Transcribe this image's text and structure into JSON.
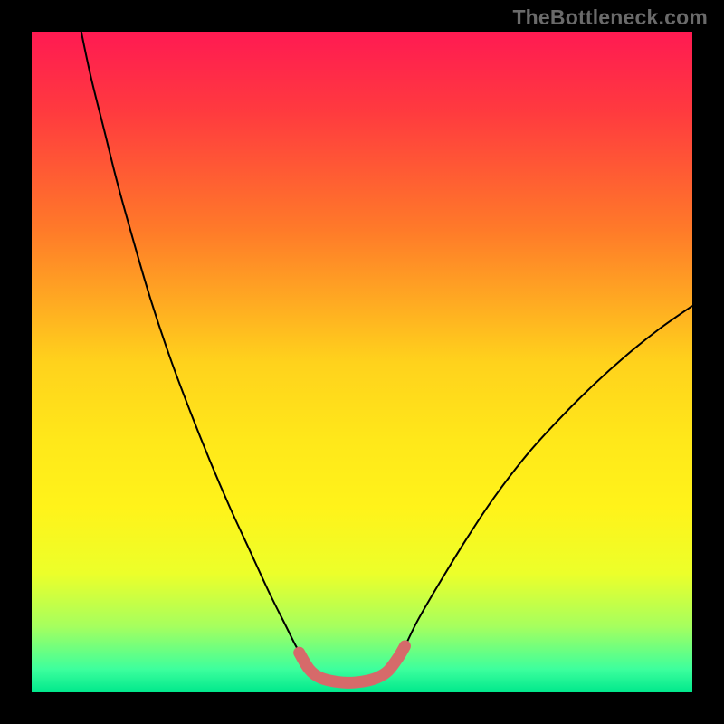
{
  "watermark": "TheBottleneck.com",
  "chart_data": {
    "type": "line",
    "title": "",
    "xlabel": "",
    "ylabel": "",
    "xlim": [
      0,
      100
    ],
    "ylim": [
      0,
      100
    ],
    "gradient_stops": [
      {
        "offset": 0.0,
        "color": "#ff1a52"
      },
      {
        "offset": 0.12,
        "color": "#ff3a3f"
      },
      {
        "offset": 0.3,
        "color": "#ff7a29"
      },
      {
        "offset": 0.5,
        "color": "#ffd21c"
      },
      {
        "offset": 0.62,
        "color": "#ffe81a"
      },
      {
        "offset": 0.72,
        "color": "#fff31a"
      },
      {
        "offset": 0.82,
        "color": "#ecff2a"
      },
      {
        "offset": 0.9,
        "color": "#a6ff5e"
      },
      {
        "offset": 0.965,
        "color": "#3dff9d"
      },
      {
        "offset": 1.0,
        "color": "#00e88c"
      }
    ],
    "series": [
      {
        "name": "bottleneck-curve",
        "stroke": "#000000",
        "stroke_width": 2,
        "points": [
          {
            "x": 7.5,
            "y": 100.0
          },
          {
            "x": 9.0,
            "y": 93.0
          },
          {
            "x": 11.0,
            "y": 85.0
          },
          {
            "x": 13.0,
            "y": 77.0
          },
          {
            "x": 15.5,
            "y": 68.0
          },
          {
            "x": 18.0,
            "y": 59.5
          },
          {
            "x": 21.0,
            "y": 50.5
          },
          {
            "x": 24.0,
            "y": 42.5
          },
          {
            "x": 27.0,
            "y": 35.0
          },
          {
            "x": 30.0,
            "y": 28.0
          },
          {
            "x": 33.0,
            "y": 21.5
          },
          {
            "x": 36.0,
            "y": 15.0
          },
          {
            "x": 38.5,
            "y": 10.0
          },
          {
            "x": 40.0,
            "y": 7.0
          },
          {
            "x": 41.5,
            "y": 4.5
          },
          {
            "x": 43.0,
            "y": 2.5
          },
          {
            "x": 45.0,
            "y": 1.8
          },
          {
            "x": 47.0,
            "y": 1.5
          },
          {
            "x": 49.0,
            "y": 1.5
          },
          {
            "x": 51.0,
            "y": 1.8
          },
          {
            "x": 53.0,
            "y": 2.5
          },
          {
            "x": 55.0,
            "y": 4.5
          },
          {
            "x": 56.5,
            "y": 7.0
          },
          {
            "x": 58.5,
            "y": 11.0
          },
          {
            "x": 62.0,
            "y": 17.0
          },
          {
            "x": 66.0,
            "y": 23.5
          },
          {
            "x": 70.0,
            "y": 29.5
          },
          {
            "x": 75.0,
            "y": 36.0
          },
          {
            "x": 80.0,
            "y": 41.5
          },
          {
            "x": 85.0,
            "y": 46.5
          },
          {
            "x": 90.0,
            "y": 51.0
          },
          {
            "x": 95.0,
            "y": 55.0
          },
          {
            "x": 100.0,
            "y": 58.5
          }
        ]
      },
      {
        "name": "highlight-band",
        "stroke": "#d66a6a",
        "stroke_width": 13,
        "linecap": "round",
        "points": [
          {
            "x": 40.5,
            "y": 6.0
          },
          {
            "x": 42.0,
            "y": 3.5
          },
          {
            "x": 43.5,
            "y": 2.3
          },
          {
            "x": 45.0,
            "y": 1.8
          },
          {
            "x": 47.0,
            "y": 1.5
          },
          {
            "x": 49.0,
            "y": 1.5
          },
          {
            "x": 51.0,
            "y": 1.8
          },
          {
            "x": 52.5,
            "y": 2.3
          },
          {
            "x": 54.0,
            "y": 3.3
          },
          {
            "x": 55.5,
            "y": 5.3
          },
          {
            "x": 56.5,
            "y": 7.0
          }
        ]
      }
    ]
  }
}
